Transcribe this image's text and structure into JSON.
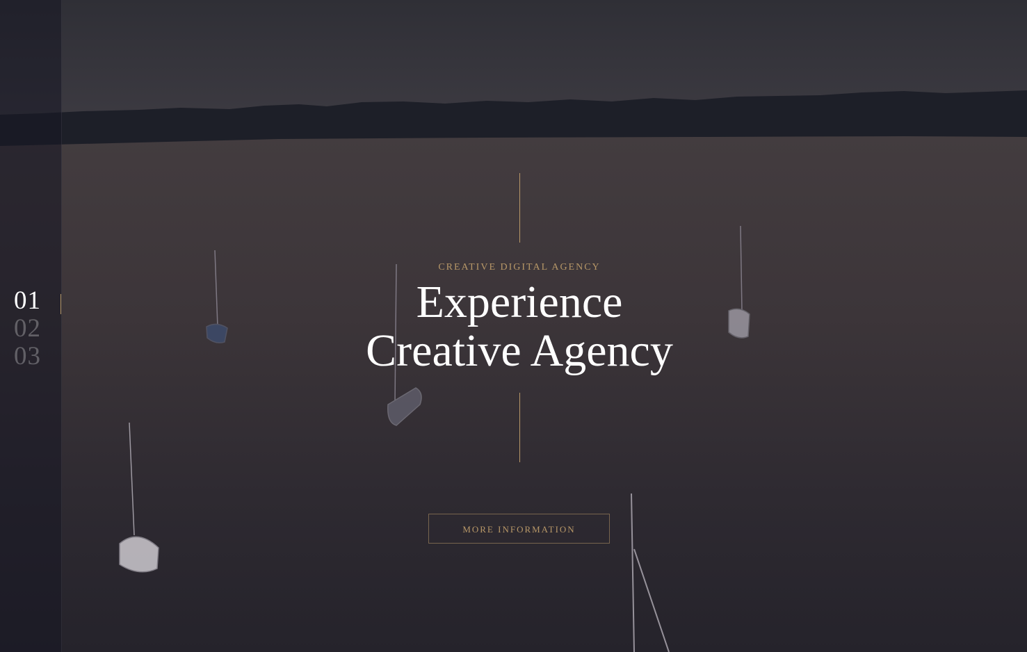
{
  "slider": {
    "items": [
      {
        "label": "01",
        "active": true
      },
      {
        "label": "02",
        "active": false
      },
      {
        "label": "03",
        "active": false
      }
    ]
  },
  "hero": {
    "kicker": "CREATIVE DIGITAL AGENCY",
    "headline_line1": "Experience",
    "headline_line2": "Creative Agency",
    "cta_label": "MORE INFORMATION"
  },
  "colors": {
    "accent": "#b89868",
    "text_primary": "#ffffff",
    "background": "#2b2931"
  }
}
